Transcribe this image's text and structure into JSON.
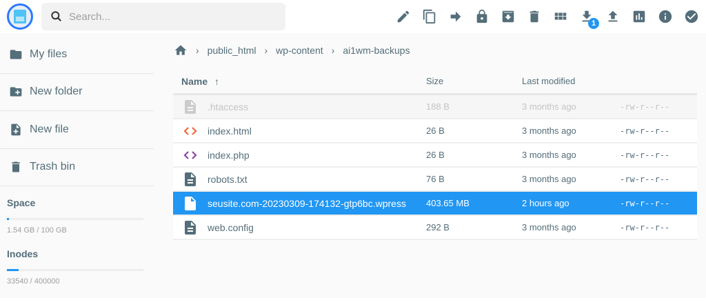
{
  "search": {
    "placeholder": "Search..."
  },
  "toolbar": {
    "badge": "1",
    "items": [
      "rename",
      "copy",
      "move",
      "permissions",
      "archive",
      "delete",
      "switch-view",
      "download",
      "upload",
      "usage",
      "info",
      "select"
    ]
  },
  "sidebar": {
    "items": [
      {
        "label": "My files"
      },
      {
        "label": "New folder"
      },
      {
        "label": "New file"
      },
      {
        "label": "Trash bin"
      }
    ],
    "space": {
      "title": "Space",
      "text": "1.54 GB / 100 GB",
      "fraction": 0.0154
    },
    "inodes": {
      "title": "Inodes",
      "text": "33540 / 400000",
      "fraction": 0.0839
    }
  },
  "breadcrumb": [
    "public_html",
    "wp-content",
    "ai1wm-backups"
  ],
  "table": {
    "headers": {
      "name": "Name",
      "size": "Size",
      "modified": "Last modified"
    },
    "rows": [
      {
        "icon": "file-doc",
        "name": ".htaccess",
        "size": "188 B",
        "modified": "3 months ago",
        "perm": "-rw-r--r--",
        "state": "hidden"
      },
      {
        "icon": "code-html",
        "name": "index.html",
        "size": "26 B",
        "modified": "3 months ago",
        "perm": "-rw-r--r--"
      },
      {
        "icon": "code-php",
        "name": "index.php",
        "size": "26 B",
        "modified": "3 months ago",
        "perm": "-rw-r--r--"
      },
      {
        "icon": "file-doc",
        "name": "robots.txt",
        "size": "76 B",
        "modified": "3 months ago",
        "perm": "-rw-r--r--"
      },
      {
        "icon": "file-blank",
        "name": "seusite.com-20230309-174132-gtp6bc.wpress",
        "size": "403.65 MB",
        "modified": "2 hours ago",
        "perm": "-rw-r--r--",
        "state": "selected"
      },
      {
        "icon": "file-doc",
        "name": "web.config",
        "size": "292 B",
        "modified": "3 months ago",
        "perm": "-rw-r--r--"
      }
    ]
  },
  "colors": {
    "accent": "#2196f3",
    "html": "#f4683c",
    "php": "#8e44ad",
    "icon": "#546e7a"
  }
}
